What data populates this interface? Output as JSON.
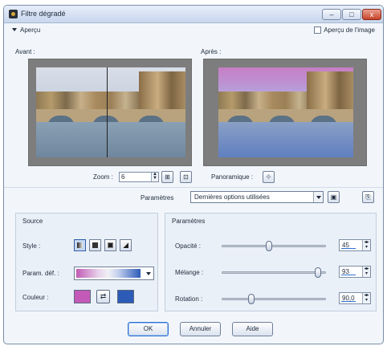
{
  "window": {
    "title": "Filtre dégradé",
    "controls": {
      "minimize": "–",
      "maximize": "□",
      "close": "x"
    }
  },
  "preview": {
    "toggle_label": "Aperçu",
    "image_preview_label": "Aperçu de l'image",
    "image_preview_checked": false
  },
  "panes": {
    "before_label": "Avant :",
    "after_label": "Après :"
  },
  "zoom": {
    "label": "Zoom :",
    "value": "6",
    "fit_icon": "fit-to-window-icon",
    "actual_icon": "actual-size-icon"
  },
  "pan": {
    "label": "Panoramique :",
    "icon": "move-icon"
  },
  "presets": {
    "label": "Paramètres",
    "selected": "Dernières options utilisées",
    "save_icon": "save-disk-icon",
    "manage_icon": "manage-presets-icon"
  },
  "source": {
    "title": "Source",
    "style_label": "Style :",
    "style_options": [
      "gradient",
      "ellipse",
      "rectangle",
      "diagonal"
    ],
    "style_selected_index": 0,
    "gradient_label": "Param. déf. :",
    "color_label": "Couleur :",
    "color_from": "#c45ab8",
    "color_to": "#2c5cb8",
    "swap_icon": "swap-colors-icon"
  },
  "parameters": {
    "title": "Paramètres",
    "sliders": [
      {
        "label": "Opacité :",
        "value": "45",
        "fraction": 0.45
      },
      {
        "label": "Mélange :",
        "value": "93",
        "fraction": 0.93
      },
      {
        "label": "Rotation :",
        "value": "90,0",
        "fraction": 0.28
      }
    ]
  },
  "buttons": {
    "ok": "OK",
    "cancel": "Annuler",
    "help": "Aide"
  }
}
